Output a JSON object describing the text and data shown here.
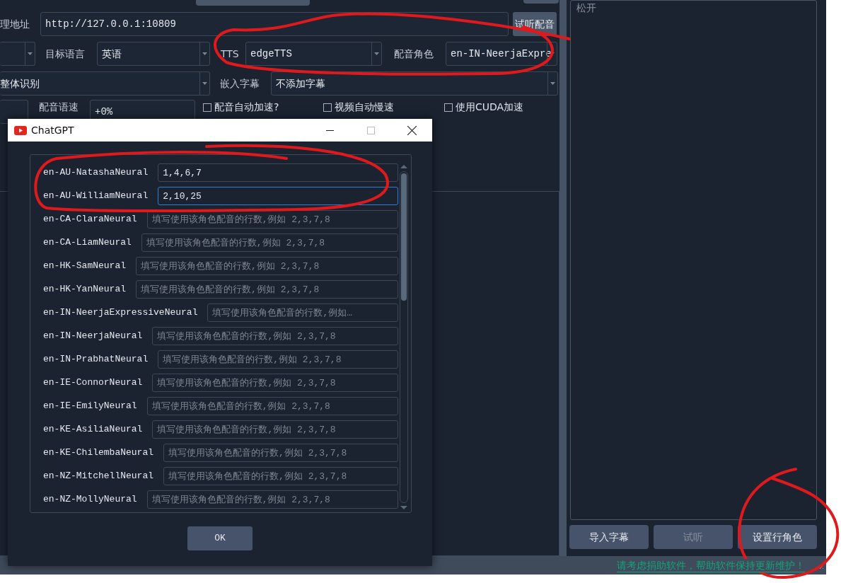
{
  "form": {
    "proxy": {
      "label": "理地址",
      "value": "http://127.0.0.1:10809"
    },
    "preview_button": "试听配音",
    "target_language": {
      "label": "目标语言",
      "value": "英语"
    },
    "tts": {
      "label": "TTS",
      "value": "edgeTTS"
    },
    "voice": {
      "label": "配音角色",
      "value": "en-IN-NeerjaExpre"
    },
    "recognition": {
      "value": "整体识别"
    },
    "subtitles": {
      "label": "嵌入字幕",
      "value": "不添加字幕"
    },
    "speed": {
      "label": "配音语速",
      "value": "+0%"
    },
    "checkboxes": [
      {
        "label": "配音自动加速?",
        "checked": false
      },
      {
        "label": "视频自动慢速",
        "checked": false
      },
      {
        "label": "使用CUDA加速",
        "checked": false
      }
    ]
  },
  "side_panel": {
    "text": "松开",
    "buttons": [
      {
        "label": "导入字幕",
        "disabled": false
      },
      {
        "label": "试听",
        "disabled": true
      },
      {
        "label": "设置行角色",
        "disabled": false
      }
    ]
  },
  "status_bar": {
    "link": "请考虑捐助软件，帮助软件保持更新维护！"
  },
  "dialog": {
    "title": "ChatGPT",
    "roles": [
      {
        "name": "en-AU-NatashaNeural",
        "value": "1,4,6,7",
        "focused": false
      },
      {
        "name": "en-AU-WilliamNeural",
        "value": "2,10,25",
        "focused": true
      },
      {
        "name": "en-CA-ClaraNeural",
        "placeholder": "填写使用该角色配音的行数,例如 2,3,7,8",
        "focused": false
      },
      {
        "name": "en-CA-LiamNeural",
        "placeholder": "填写使用该角色配音的行数,例如 2,3,7,8",
        "focused": false
      },
      {
        "name": "en-HK-SamNeural",
        "placeholder": "填写使用该角色配音的行数,例如 2,3,7,8",
        "focused": false
      },
      {
        "name": "en-HK-YanNeural",
        "placeholder": "填写使用该角色配音的行数,例如 2,3,7,8",
        "focused": false
      },
      {
        "name": "en-IN-NeerjaExpressiveNeural",
        "placeholder": "填写使用该角色配音的行数,例如…",
        "focused": false
      },
      {
        "name": "en-IN-NeerjaNeural",
        "placeholder": "填写使用该角色配音的行数,例如 2,3,7,8",
        "focused": false
      },
      {
        "name": "en-IN-PrabhatNeural",
        "placeholder": "填写使用该角色配音的行数,例如 2,3,7,8",
        "focused": false
      },
      {
        "name": "en-IE-ConnorNeural",
        "placeholder": "填写使用该角色配音的行数,例如 2,3,7,8",
        "focused": false
      },
      {
        "name": "en-IE-EmilyNeural",
        "placeholder": "填写使用该角色配音的行数,例如 2,3,7,8",
        "focused": false
      },
      {
        "name": "en-KE-AsiliaNeural",
        "placeholder": "填写使用该角色配音的行数,例如 2,3,7,8",
        "focused": false
      },
      {
        "name": "en-KE-ChilembaNeural",
        "placeholder": "填写使用该角色配音的行数,例如 2,3,7,8",
        "focused": false
      },
      {
        "name": "en-NZ-MitchellNeural",
        "placeholder": "填写使用该角色配音的行数,例如 2,3,7,8",
        "focused": false
      },
      {
        "name": "en-NZ-MollyNeural",
        "placeholder": "填写使用该角色配音的行数,例如 2,3,7,8",
        "focused": false
      }
    ],
    "ok_button": "OK"
  }
}
